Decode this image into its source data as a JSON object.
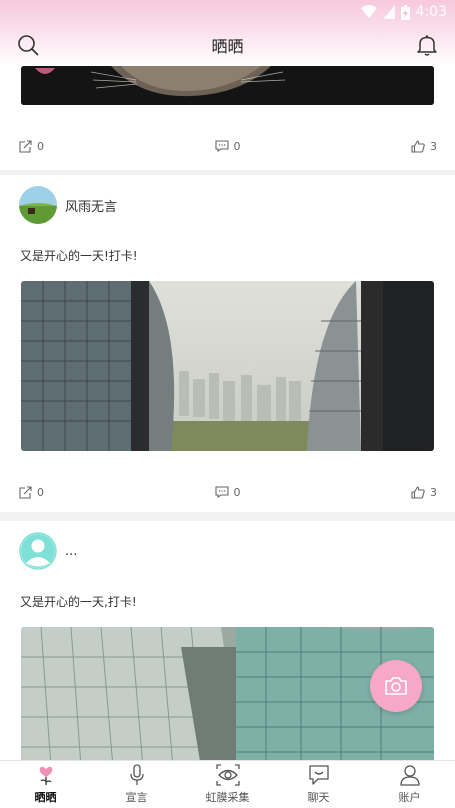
{
  "status_bar": {
    "time": "4:03"
  },
  "header": {
    "title": "晒晒"
  },
  "posts": [
    {
      "share_count": "0",
      "comment_count": "0",
      "like_count": "3"
    },
    {
      "username": "风雨无言",
      "text": "又是开心的一天!打卡!",
      "share_count": "0",
      "comment_count": "0",
      "like_count": "3"
    },
    {
      "username": "...",
      "text": "又是开心的一天,打卡!"
    }
  ],
  "tabs": [
    {
      "label": "晒晒",
      "icon": "heart-plant-icon",
      "active": true
    },
    {
      "label": "宣言",
      "icon": "microphone-icon"
    },
    {
      "label": "虹膜采集",
      "icon": "eye-scan-icon"
    },
    {
      "label": "聊天",
      "icon": "chat-icon"
    },
    {
      "label": "账户",
      "icon": "user-icon"
    }
  ],
  "colors": {
    "accent": "#f7a8c8",
    "header_top": "#f7c9dc",
    "background": "#f2f2f2"
  }
}
